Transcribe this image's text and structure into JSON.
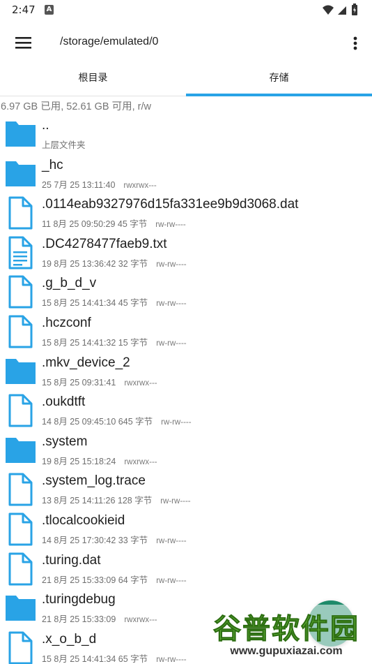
{
  "status": {
    "time": "2:47",
    "notification_letter": "A"
  },
  "toolbar": {
    "path": "/storage/emulated/0",
    "menu_icon": "hamburger-menu-icon",
    "more_icon": "more-vert-icon"
  },
  "tabs": [
    {
      "label": "根目录",
      "selected": false
    },
    {
      "label": "存储",
      "selected": true
    }
  ],
  "storage_info": "6.97 GB 已用, 52.61 GB 可用, r/w",
  "files": [
    {
      "name": "..",
      "meta": "上层文件夹",
      "perm": "",
      "type": "folder"
    },
    {
      "name": "_hc",
      "meta": "25 7月 25 13:11:40",
      "perm": "rwxrwx---",
      "type": "folder"
    },
    {
      "name": ".0114eab9327976d15fa331ee9b9d3068.dat",
      "meta": "11 8月 25 09:50:29  45 字节",
      "perm": "rw-rw----",
      "type": "file"
    },
    {
      "name": ".DC4278477faeb9.txt",
      "meta": "19 8月 25 13:36:42  32 字节",
      "perm": "rw-rw----",
      "type": "text"
    },
    {
      "name": ".g_b_d_v",
      "meta": "15 8月 25 14:41:34  45 字节",
      "perm": "rw-rw----",
      "type": "file"
    },
    {
      "name": ".hczconf",
      "meta": "15 8月 25 14:41:32  15 字节",
      "perm": "rw-rw----",
      "type": "file"
    },
    {
      "name": ".mkv_device_2",
      "meta": "15 8月 25 09:31:41",
      "perm": "rwxrwx---",
      "type": "folder"
    },
    {
      "name": ".oukdtft",
      "meta": "14 8月 25 09:45:10  645 字节",
      "perm": "rw-rw----",
      "type": "file"
    },
    {
      "name": ".system",
      "meta": "19 8月 25 15:18:24",
      "perm": "rwxrwx---",
      "type": "folder"
    },
    {
      "name": ".system_log.trace",
      "meta": "13 8月 25 14:11:26  128 字节",
      "perm": "rw-rw----",
      "type": "file"
    },
    {
      "name": ".tlocalcookieid",
      "meta": "14 8月 25 17:30:42  33 字节",
      "perm": "rw-rw----",
      "type": "file"
    },
    {
      "name": ".turing.dat",
      "meta": "21 8月 25 15:33:09  64 字节",
      "perm": "rw-rw----",
      "type": "file"
    },
    {
      "name": ".turingdebug",
      "meta": "21 8月 25 15:33:09",
      "perm": "rwxrwx---",
      "type": "folder"
    },
    {
      "name": ".x_o_b_d",
      "meta": "15 8月 25 14:41:34  65 字节",
      "perm": "rw-rw----",
      "type": "file"
    }
  ],
  "watermark": {
    "title": "谷普软件园",
    "url": "www.gupuxiazai.com"
  },
  "colors": {
    "accent": "#29a3e6",
    "folder": "#29a3e6",
    "fab": "#1e8a6a"
  }
}
